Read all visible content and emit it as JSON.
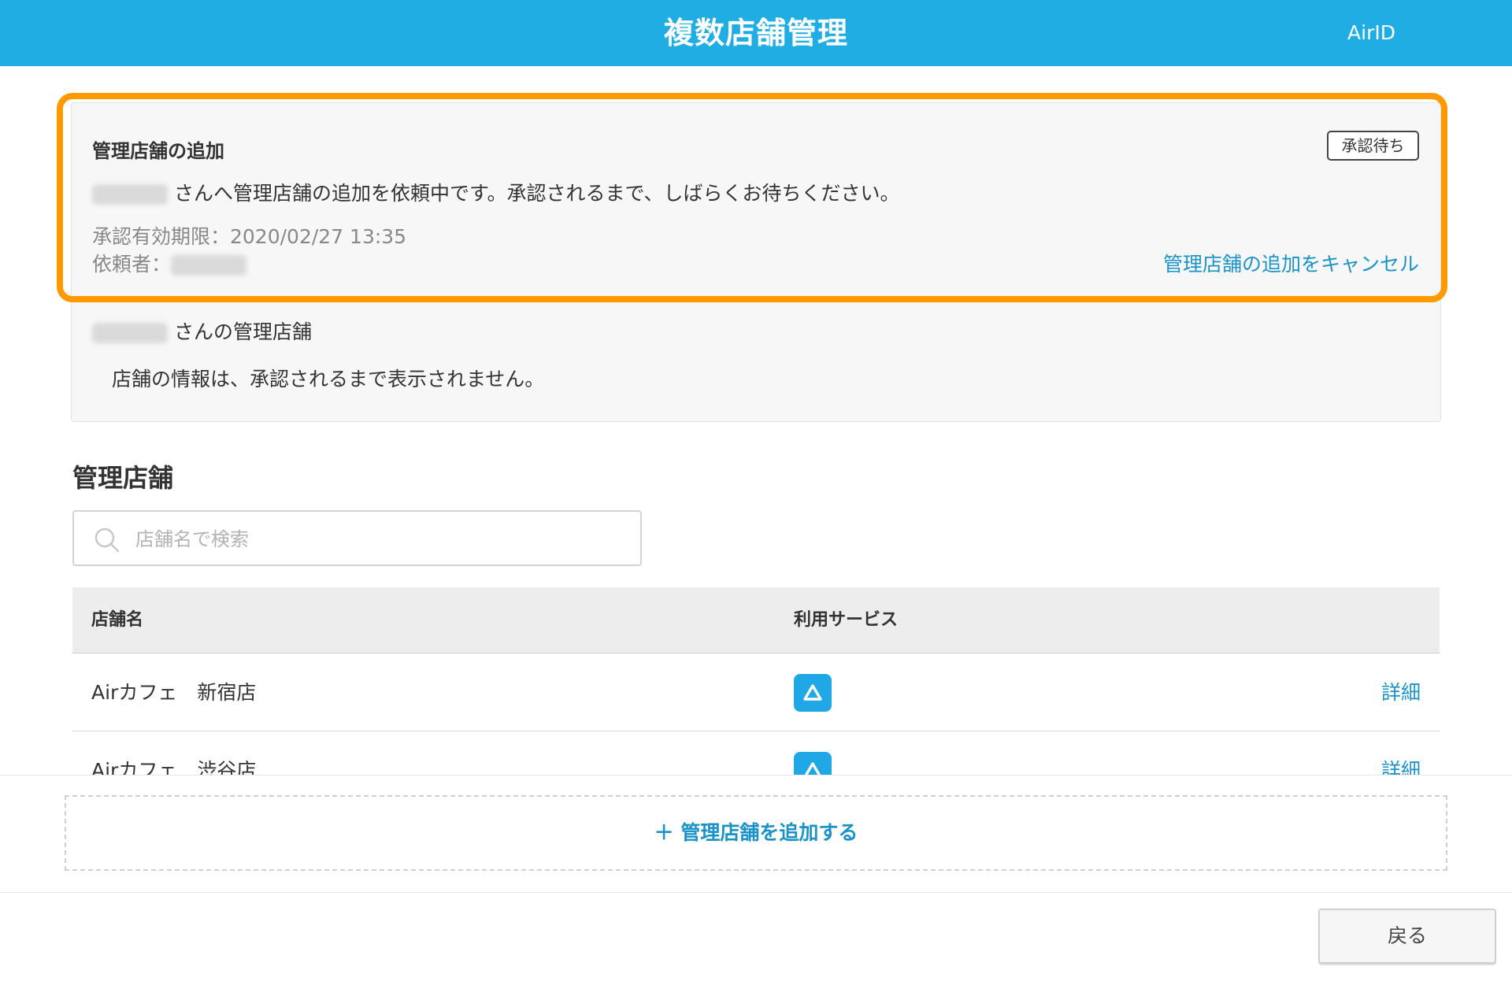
{
  "header": {
    "title": "複数店舗管理",
    "account_label": "AirID"
  },
  "request_card": {
    "title": "管理店舗の追加",
    "status_badge": "承認待ち",
    "message": "さんへ管理店舗の追加を依頼中です。承認されるまで、しばらくお待ちください。",
    "expiry": "承認有効期限：2020/02/27 13:35",
    "requester_label": "依頼者：",
    "cancel_link": "管理店舗の追加をキャンセル",
    "managed_stores_label": "さんの管理店舗",
    "info_note": "店舗の情報は、承認されるまで表示されません。"
  },
  "managed": {
    "section_title": "管理店舗",
    "search_placeholder": "店舗名で検索",
    "columns": [
      "店舗名",
      "利用サービス"
    ],
    "rows": [
      {
        "name": "Airカフェ　新宿店",
        "service_icon": "airid-triangle-icon",
        "detail": "詳細"
      },
      {
        "name": "Airカフェ　渋谷店",
        "service_icon": "airid-triangle-icon",
        "detail": "詳細"
      }
    ]
  },
  "add_store_button": "＋ 管理店舗を追加する",
  "back_button": "戻る",
  "colors": {
    "header": "#1fade3",
    "highlight": "#ff9900",
    "link": "#1b93c8",
    "service_icon": "#1fa7e6"
  }
}
